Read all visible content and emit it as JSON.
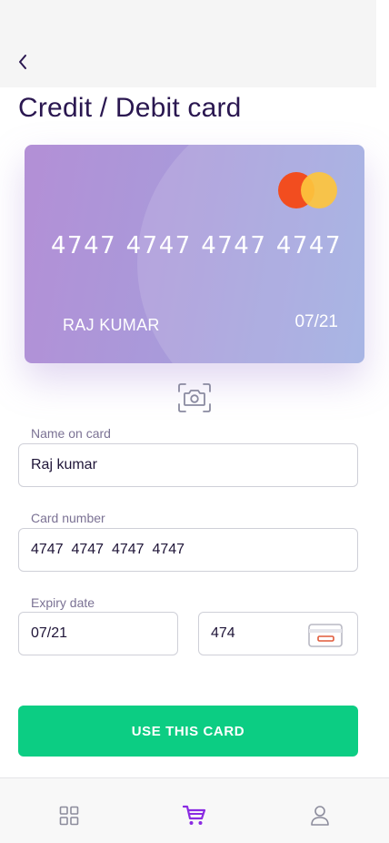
{
  "header": {
    "back_icon": "chevron-left-icon",
    "title": "Credit / Debit card"
  },
  "card_preview": {
    "number_groups": [
      "4747",
      "4747",
      "4747",
      "4747"
    ],
    "holder": "RAJ KUMAR",
    "expiry": "07/21",
    "brand_icon": "mastercard-logo",
    "gradient_colors": [
      "#b38fd6",
      "#9cabe0"
    ]
  },
  "scan": {
    "icon": "camera-icon"
  },
  "form": {
    "name_label": "Name on card",
    "name_value": "Raj kumar",
    "number_label": "Card number",
    "number_value": "4747  4747  4747  4747",
    "expiry_label": "Expiry date",
    "expiry_value": "07/21",
    "cvv_value": "474",
    "cvv_icon": "card-back-icon"
  },
  "actions": {
    "submit_label": "USE THIS CARD",
    "accent": "#0ccd83"
  },
  "bottom_nav": {
    "items": [
      {
        "icon": "grid-icon",
        "active": false
      },
      {
        "icon": "cart-icon",
        "active": true
      },
      {
        "icon": "user-icon",
        "active": false
      }
    ],
    "active_color": "#8a2be2"
  }
}
